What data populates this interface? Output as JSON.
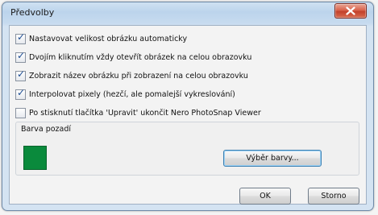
{
  "window": {
    "title": "Předvolby"
  },
  "options": [
    {
      "label": "Nastavovat velikost obrázku automaticky",
      "checked": true
    },
    {
      "label": "Dvojím kliknutím vždy otevřít obrázek na celou obrazovku",
      "checked": true
    },
    {
      "label": "Zobrazit název obrázku při zobrazení na celou obrazovku",
      "checked": true
    },
    {
      "label": "Interpolovat pixely (hezčí, ale pomalejší vykreslování)",
      "checked": true
    },
    {
      "label": "Po stisknutí tlačítka 'Upravit' ukončit Nero PhotoSnap Viewer",
      "checked": false
    }
  ],
  "background_group": {
    "label": "Barva pozadí",
    "color": "#0a8a3c",
    "choose_button": "Výběr barvy..."
  },
  "buttons": {
    "ok": "OK",
    "cancel": "Storno"
  },
  "icons": {
    "close": "close-icon",
    "check": "checkmark-icon"
  }
}
